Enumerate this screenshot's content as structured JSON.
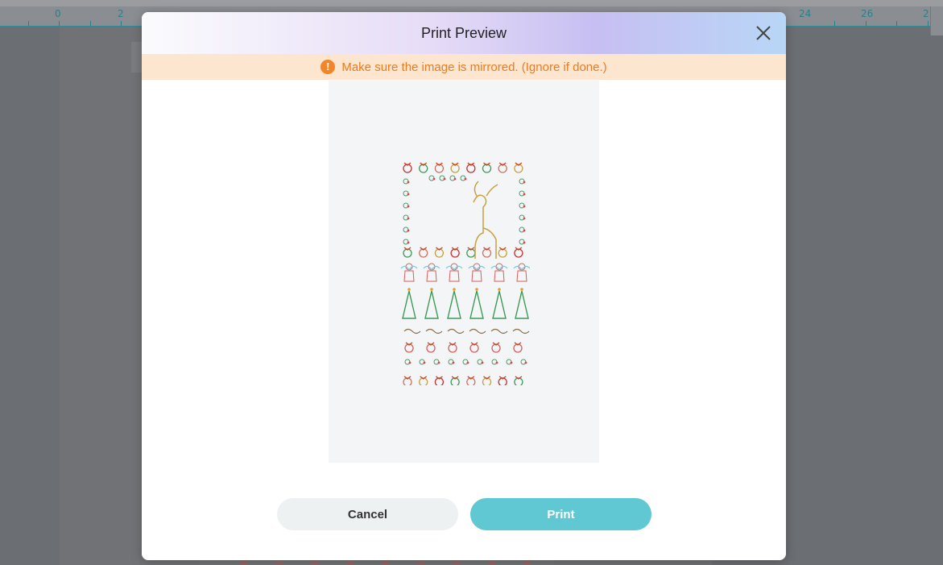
{
  "ruler": {
    "labels": [
      "0",
      "2",
      "24",
      "26",
      "2"
    ]
  },
  "dialog": {
    "title": "Print Preview",
    "close_icon": "close-icon",
    "warning": {
      "icon": "exclamation-circle-icon",
      "text": "Make sure the image is mirrored. (Ignore if done.)"
    },
    "buttons": {
      "cancel_label": "Cancel",
      "print_label": "Print"
    }
  },
  "colors": {
    "accent": "#5fc8d2",
    "warning_text": "#ec7a1e",
    "warning_bg": "#fde6d0"
  }
}
